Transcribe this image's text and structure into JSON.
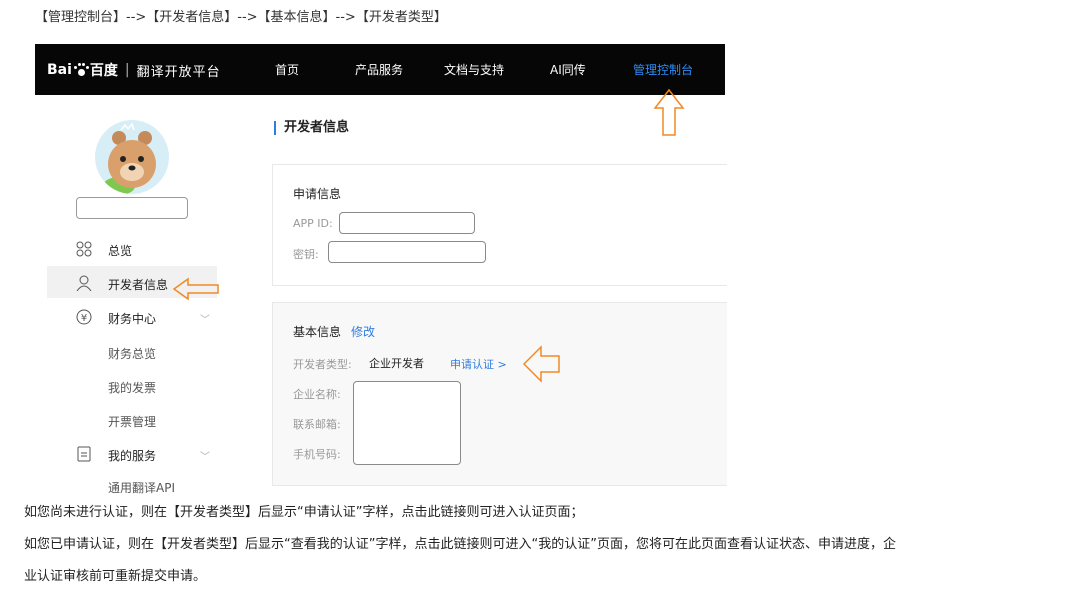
{
  "breadcrumb": "【管理控制台】-->【开发者信息】-->【基本信息】-->【开发者类型】",
  "nav": {
    "logo_bai": "Bai",
    "logo_du": "百度",
    "logo_sep": "|",
    "logo_platform": "翻译开放平台",
    "items": [
      "首页",
      "产品服务",
      "文档与支持",
      "AI同传",
      "管理控制台"
    ],
    "active_color": "#2f8df3"
  },
  "sidebar": {
    "overview": "总览",
    "developer_info": "开发者信息",
    "finance": "财务中心",
    "finance_sub": [
      "财务总览",
      "我的发票",
      "开票管理"
    ],
    "my_services": "我的服务",
    "general_api": "通用翻译API"
  },
  "main": {
    "title": "开发者信息",
    "apply_info": {
      "heading": "申请信息",
      "app_id_label": "APP ID:",
      "secret_label": "密钥:"
    },
    "basic_info": {
      "heading": "基本信息",
      "edit": "修改",
      "dev_type_label": "开发者类型:",
      "dev_type_value": "企业开发者",
      "apply_cert": "申请认证 >",
      "company_label": "企业名称:",
      "email_label": "联系邮箱:",
      "phone_label": "手机号码:"
    }
  },
  "notes": {
    "line1": "如您尚未进行认证，则在【开发者类型】后显示“申请认证”字样，点击此链接则可进入认证页面；",
    "line2": "如您已申请认证，则在【开发者类型】后显示“查看我的认证”字样，点击此链接则可进入“我的认证”页面，您将可在此页面查看认证状态、申请进度，企",
    "line3": "业认证审核前可重新提交申请。"
  },
  "colors": {
    "accent": "#2f7de0",
    "arrow": "#f08a24"
  }
}
